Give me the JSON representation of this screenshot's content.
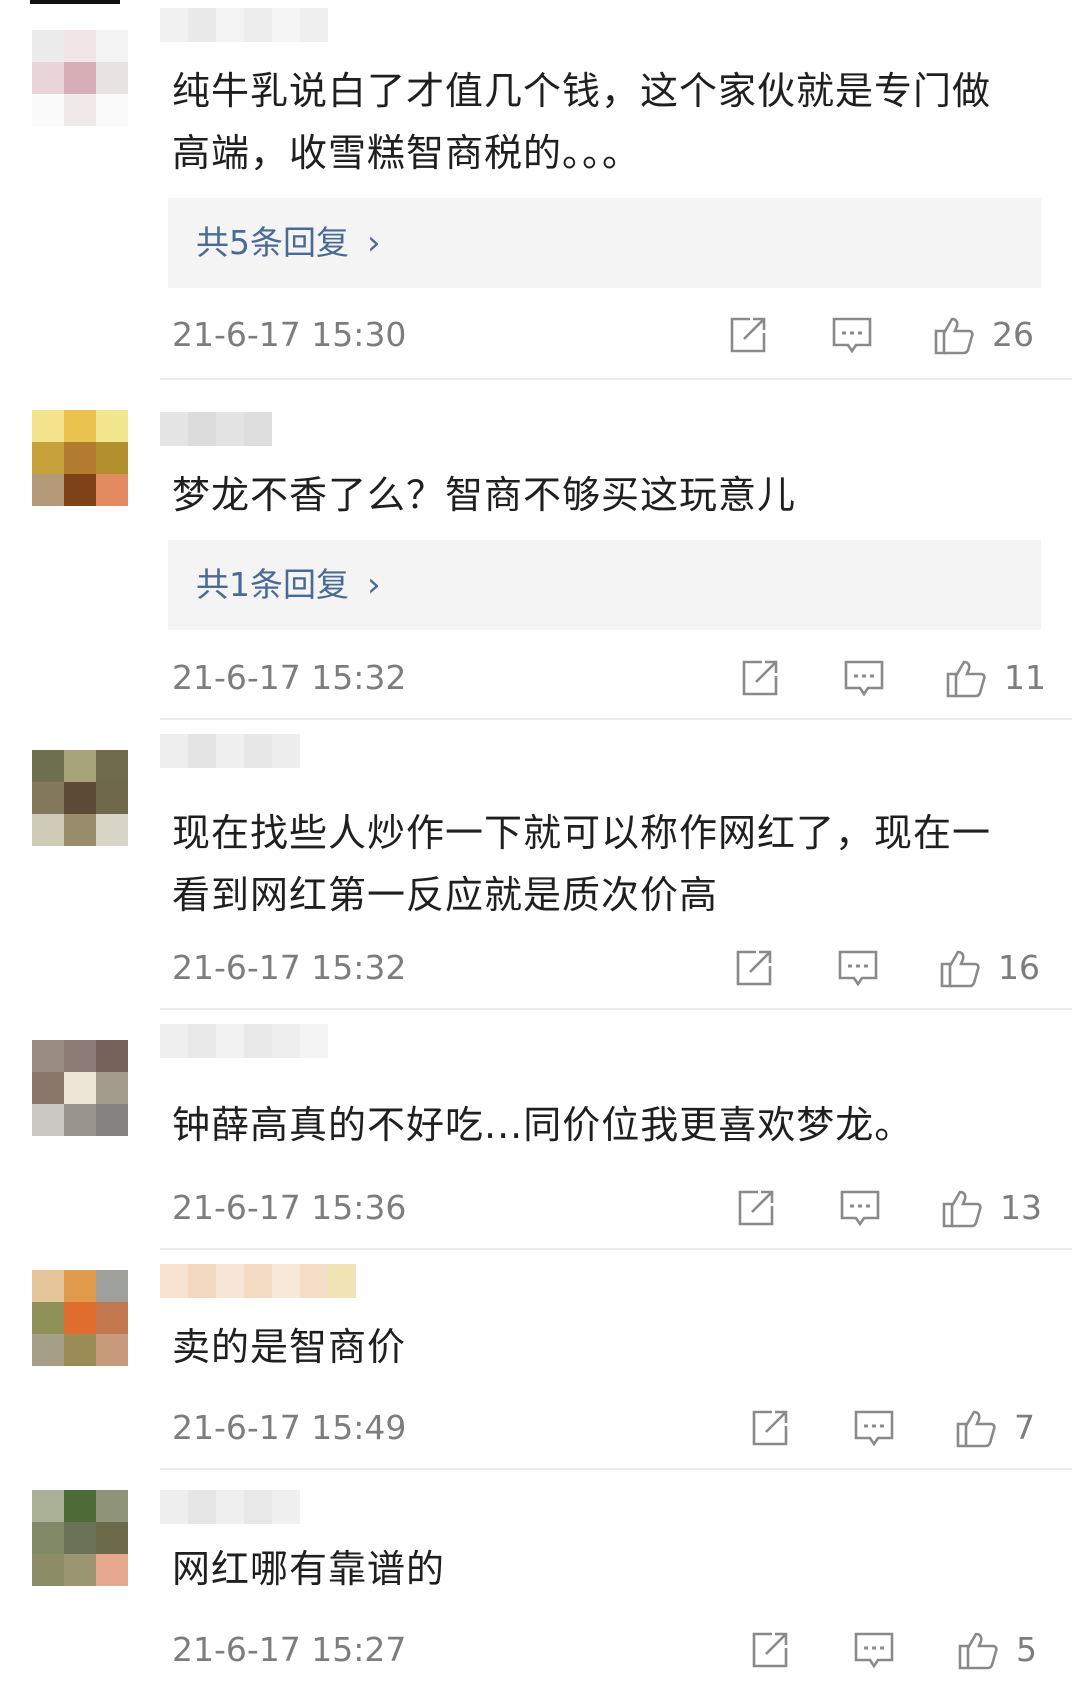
{
  "comments": [
    {
      "text": "纯牛乳说白了才值几个钱，这个家伙就是专门做\n高端，收雪糕智商税的。。。",
      "reply_label": "共5条回复",
      "time": "21-6-17 15:30",
      "likes": "26"
    },
    {
      "text": "梦龙不香了么？智商不够买这玩意儿",
      "reply_label": "共1条回复",
      "time": "21-6-17 15:32",
      "likes": "11"
    },
    {
      "text": "现在找些人炒作一下就可以称作网红了，现在一\n看到网红第一反应就是质次价高",
      "time": "21-6-17 15:32",
      "likes": "16"
    },
    {
      "text": "钟薛高真的不好吃...同价位我更喜欢梦龙。",
      "time": "21-6-17 15:36",
      "likes": "13"
    },
    {
      "text": "卖的是智商价",
      "time": "21-6-17 15:49",
      "likes": "7"
    },
    {
      "text": "网红哪有靠谱的",
      "time": "21-6-17 15:27",
      "likes": "5"
    }
  ],
  "icons": {
    "share": "share-icon",
    "comment": "comment-icon",
    "like": "thumbs-up-icon"
  },
  "colors": {
    "link": "#4a6a95",
    "meta": "#7d7d7d",
    "reply_bg": "#f4f4f4"
  }
}
